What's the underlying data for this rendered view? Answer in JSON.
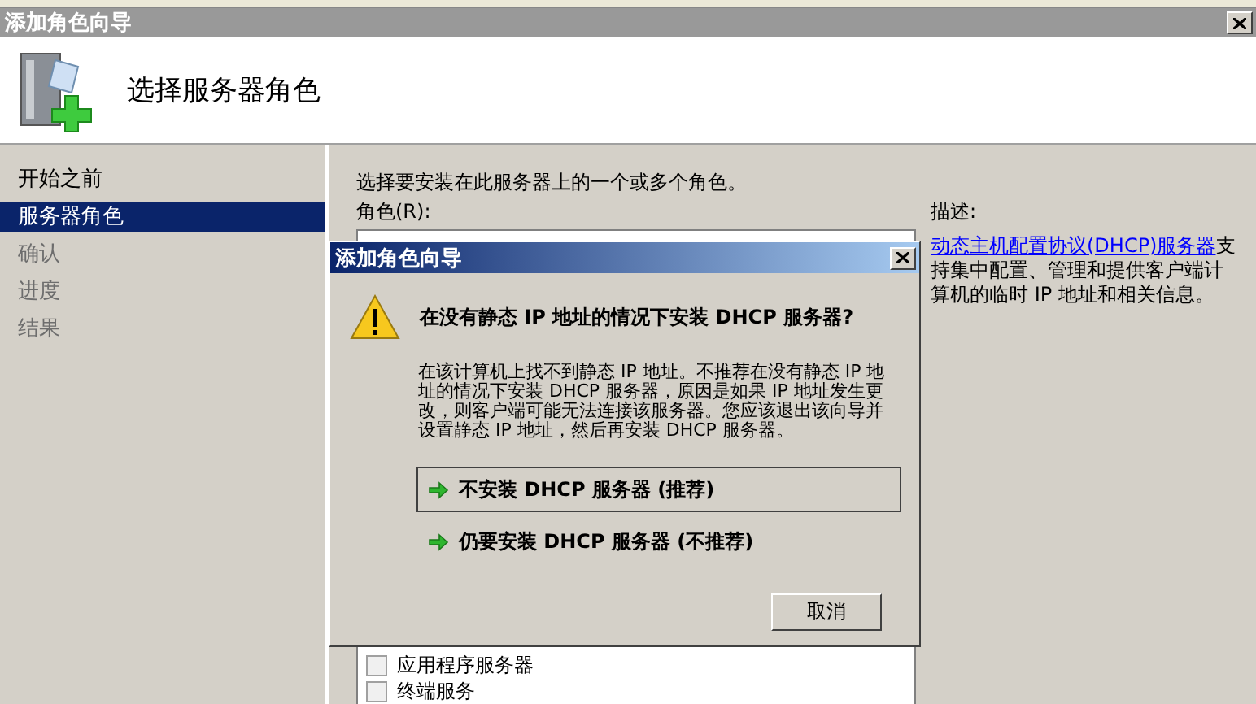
{
  "window": {
    "title": "添加角色向导"
  },
  "header": {
    "title": "选择服务器角色"
  },
  "nav": [
    {
      "label": "开始之前",
      "selected": false,
      "disabled": false
    },
    {
      "label": "服务器角色",
      "selected": true,
      "disabled": false
    },
    {
      "label": "确认",
      "selected": false,
      "disabled": true
    },
    {
      "label": "进度",
      "selected": false,
      "disabled": true
    },
    {
      "label": "结果",
      "selected": false,
      "disabled": true
    }
  ],
  "content": {
    "instruction": "选择要安装在此服务器上的一个或多个角色。",
    "roles_label": "角色(R):",
    "roles": [
      {
        "label": "应用程序服务器",
        "checked": false
      },
      {
        "label": "终端服务",
        "checked": false
      }
    ],
    "description_label": "描述:",
    "description_link": "动态主机配置协议(DHCP)服务器",
    "description_text": "支持集中配置、管理和提供客户端计算机的临时 IP 地址和相关信息。"
  },
  "dialog": {
    "title": "添加角色向导",
    "heading": "在没有静态 IP 地址的情况下安装 DHCP 服务器?",
    "message": "在该计算机上找不到静态 IP 地址。不推荐在没有静态 IP 地址的情况下安装 DHCP 服务器，原因是如果 IP 地址发生更改，则客户端可能无法连接该服务器。您应该退出该向导并设置静态 IP 地址，然后再安装 DHCP 服务器。",
    "options": [
      {
        "label": "不安装 DHCP 服务器 (推荐)",
        "focused": true
      },
      {
        "label": "仍要安装 DHCP 服务器 (不推荐)",
        "focused": false
      }
    ],
    "cancel": "取消"
  }
}
